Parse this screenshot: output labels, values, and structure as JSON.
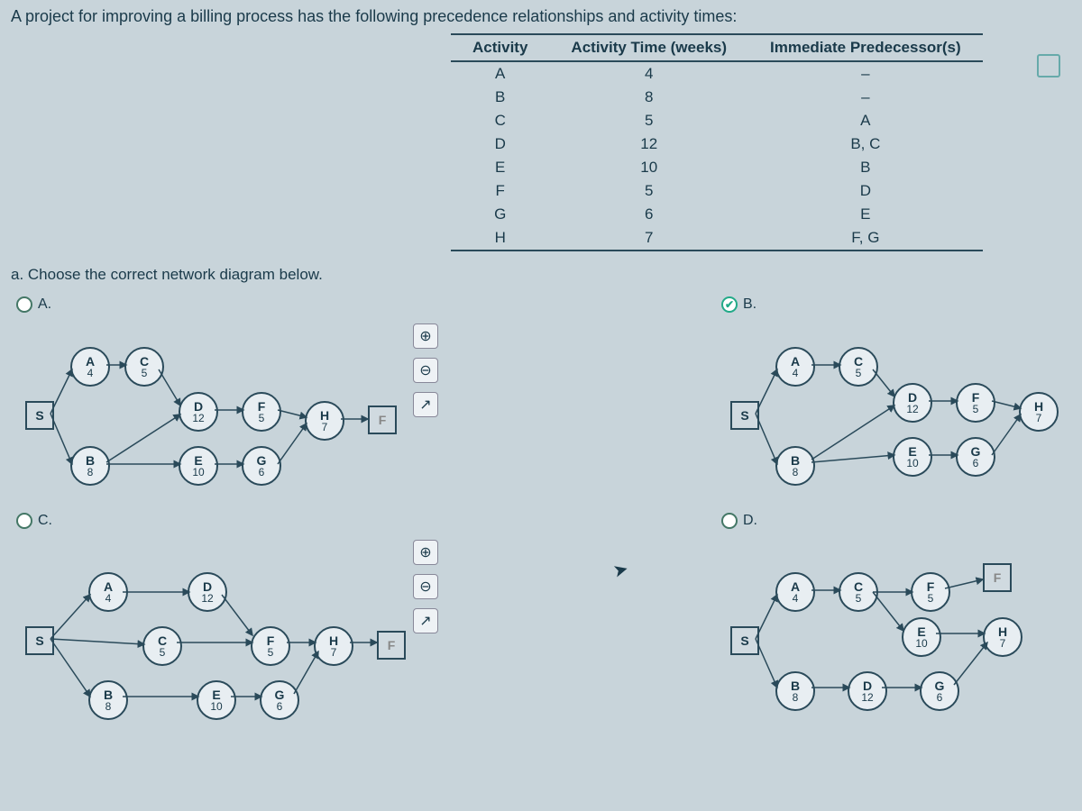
{
  "intro": "A project for improving a billing process has the following precedence relationships and activity times:",
  "table": {
    "headers": [
      "Activity",
      "Activity Time (weeks)",
      "Immediate Predecessor(s)"
    ],
    "rows": [
      [
        "A",
        "4",
        "–"
      ],
      [
        "B",
        "8",
        "–"
      ],
      [
        "C",
        "5",
        "A"
      ],
      [
        "D",
        "12",
        "B, C"
      ],
      [
        "E",
        "10",
        "B"
      ],
      [
        "F",
        "5",
        "D"
      ],
      [
        "G",
        "6",
        "E"
      ],
      [
        "H",
        "7",
        "F, G"
      ]
    ]
  },
  "part_a": "a. Choose the correct network diagram below.",
  "options": {
    "A": {
      "label": "A.",
      "selected": false
    },
    "B": {
      "label": "B.",
      "selected": true
    },
    "C": {
      "label": "C.",
      "selected": false
    },
    "D": {
      "label": "D.",
      "selected": false
    }
  },
  "diag_shared": {
    "start": "S",
    "end": "F",
    "nodes": [
      {
        "id": "A",
        "l": "A",
        "v": "4"
      },
      {
        "id": "B",
        "l": "B",
        "v": "8"
      },
      {
        "id": "C",
        "l": "C",
        "v": "5"
      },
      {
        "id": "D",
        "l": "D",
        "v": "12"
      },
      {
        "id": "E",
        "l": "E",
        "v": "10"
      },
      {
        "id": "F",
        "l": "F",
        "v": "5"
      },
      {
        "id": "G",
        "l": "G",
        "v": "6"
      },
      {
        "id": "H",
        "l": "H",
        "v": "7"
      }
    ],
    "pop_icon": "↗"
  },
  "tools": {
    "zoom_in": "⊕",
    "zoom_out": "⊖",
    "popout": "↗"
  },
  "chart_data": {
    "type": "table",
    "title": "Project precedence relationships and activity times",
    "columns": [
      "Activity",
      "Activity Time (weeks)",
      "Immediate Predecessor(s)"
    ],
    "rows": [
      {
        "Activity": "A",
        "Activity Time (weeks)": 4,
        "Immediate Predecessor(s)": null
      },
      {
        "Activity": "B",
        "Activity Time (weeks)": 8,
        "Immediate Predecessor(s)": null
      },
      {
        "Activity": "C",
        "Activity Time (weeks)": 5,
        "Immediate Predecessor(s)": [
          "A"
        ]
      },
      {
        "Activity": "D",
        "Activity Time (weeks)": 12,
        "Immediate Predecessor(s)": [
          "B",
          "C"
        ]
      },
      {
        "Activity": "E",
        "Activity Time (weeks)": 10,
        "Immediate Predecessor(s)": [
          "B"
        ]
      },
      {
        "Activity": "F",
        "Activity Time (weeks)": 5,
        "Immediate Predecessor(s)": [
          "D"
        ]
      },
      {
        "Activity": "G",
        "Activity Time (weeks)": 6,
        "Immediate Predecessor(s)": [
          "E"
        ]
      },
      {
        "Activity": "H",
        "Activity Time (weeks)": 7,
        "Immediate Predecessor(s)": [
          "F",
          "G"
        ]
      }
    ],
    "question": "Choose the correct network diagram below.",
    "correct_option": "B"
  }
}
